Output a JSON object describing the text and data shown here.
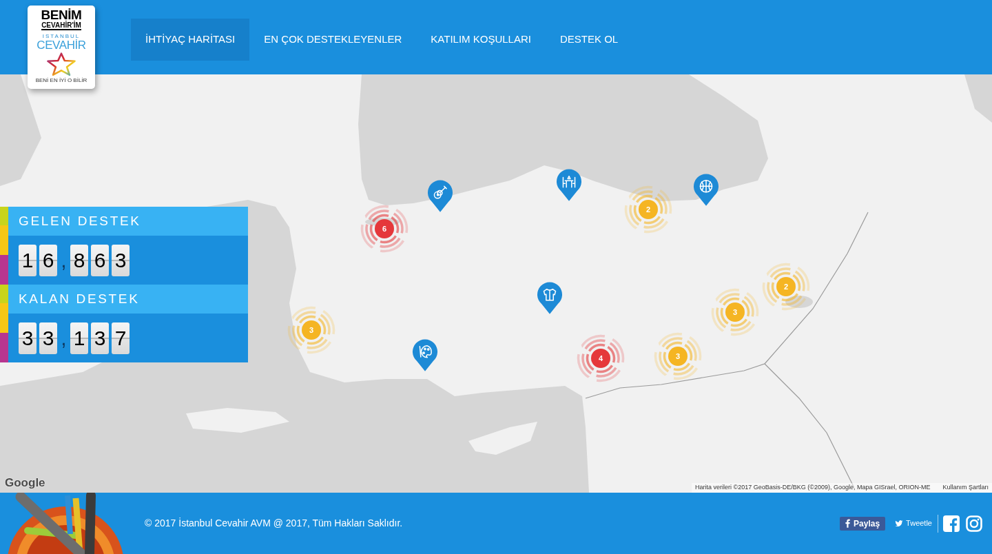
{
  "header": {
    "logo": {
      "wordmark": "BENİM",
      "wordmark_sub": "CEVAHİR'İM",
      "brand_top": "ISTANBUL",
      "brand": "CEVAHİR",
      "tagline": "BENİ EN İYİ O BİLİR"
    },
    "nav": [
      {
        "label": "İHTİYAÇ HARİTASI",
        "selected": true
      },
      {
        "label": "EN ÇOK DESTEKLEYENLER",
        "selected": false
      },
      {
        "label": "KATILIM KOŞULLARI",
        "selected": false
      },
      {
        "label": "DESTEK OL",
        "selected": false
      }
    ]
  },
  "stats": [
    {
      "label": "GELEN DESTEK",
      "tiles": [
        {
          "kind": "digit",
          "text": "1"
        },
        {
          "kind": "digit",
          "text": "6"
        },
        {
          "kind": "separator",
          "text": ","
        },
        {
          "kind": "digit",
          "text": "8"
        },
        {
          "kind": "digit",
          "text": "6"
        },
        {
          "kind": "digit",
          "text": "3"
        }
      ]
    },
    {
      "label": "KALAN DESTEK",
      "tiles": [
        {
          "kind": "digit",
          "text": "3"
        },
        {
          "kind": "digit",
          "text": "3"
        },
        {
          "kind": "separator",
          "text": ","
        },
        {
          "kind": "digit",
          "text": "1"
        },
        {
          "kind": "digit",
          "text": "3"
        },
        {
          "kind": "digit",
          "text": "7"
        }
      ]
    }
  ],
  "map": {
    "clusters": [
      {
        "count": "2",
        "color": "#f5b523"
      },
      {
        "count": "6",
        "color": "#e5383b"
      },
      {
        "count": "2",
        "color": "#f5b523"
      },
      {
        "count": "3",
        "color": "#f5b523"
      },
      {
        "count": "3",
        "color": "#f5b523"
      },
      {
        "count": "3",
        "color": "#f5b523"
      },
      {
        "count": "4",
        "color": "#e5383b"
      }
    ],
    "logo": "Google",
    "attribution": "Harita verileri ©2017 GeoBasis-DE/BKG (©2009), Google, Mapa GISrael, ORION-ME",
    "terms_link": "Kullanım Şartları"
  },
  "footer": {
    "copyright": "© 2017 İstanbul Cevahir AVM @ 2017, Tüm Hakları Saklıdır.",
    "share_buttons": [
      {
        "kind": "facebook",
        "label": "Paylaş"
      },
      {
        "kind": "twitter",
        "label": "Tweetle"
      }
    ]
  }
}
